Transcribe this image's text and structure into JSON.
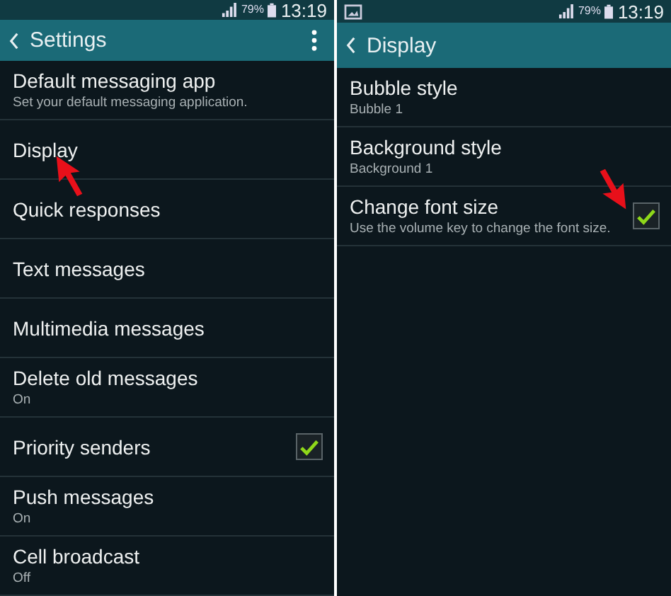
{
  "screens": [
    {
      "status_bar": {
        "image_notification": false,
        "battery": "79%",
        "time": "13:19"
      },
      "action_bar": {
        "title": "Settings",
        "overflow_menu": true
      },
      "items": [
        {
          "kind": "plain",
          "title": "Default messaging app",
          "subtitle": "Set your default messaging application."
        },
        {
          "kind": "plain",
          "title": "Display"
        },
        {
          "kind": "plain",
          "title": "Quick responses"
        },
        {
          "kind": "plain",
          "title": "Text messages"
        },
        {
          "kind": "plain",
          "title": "Multimedia messages"
        },
        {
          "kind": "plain",
          "title": "Delete old messages",
          "subtitle": "On"
        },
        {
          "kind": "checkbox",
          "title": "Priority senders",
          "checked": true
        },
        {
          "kind": "plain",
          "title": "Push messages",
          "subtitle": "On"
        },
        {
          "kind": "plain",
          "title": "Cell broadcast",
          "subtitle": "Off"
        }
      ]
    },
    {
      "status_bar": {
        "image_notification": true,
        "battery": "79%",
        "time": "13:19"
      },
      "action_bar": {
        "title": "Display",
        "overflow_menu": false
      },
      "items": [
        {
          "kind": "plain",
          "title": "Bubble style",
          "subtitle": "Bubble 1"
        },
        {
          "kind": "plain",
          "title": "Background style",
          "subtitle": "Background 1"
        },
        {
          "kind": "checkbox",
          "title": "Change font size",
          "subtitle": "Use the volume key to change the font size.",
          "checked": true
        }
      ]
    }
  ]
}
